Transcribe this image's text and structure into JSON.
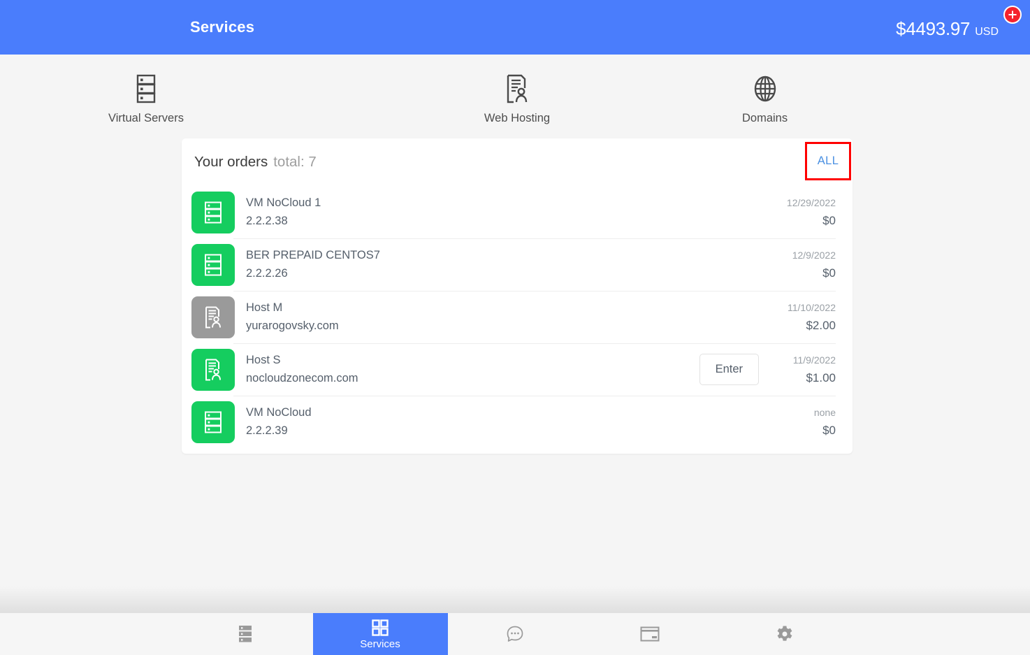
{
  "header": {
    "title": "Services",
    "balance_amount": "$4493.97",
    "balance_currency": "USD",
    "add_funds_icon": "plus-circle-icon",
    "background_color": "#4a7dfc",
    "add_funds_color": "#f5222d"
  },
  "categories": [
    {
      "label": "Virtual Servers",
      "icon": "server-rack-icon"
    },
    {
      "label": "Web Hosting",
      "icon": "document-person-icon"
    },
    {
      "label": "Domains",
      "icon": "globe-icon"
    }
  ],
  "orders_card": {
    "title": "Your orders",
    "total_label": "total: 7",
    "filter_label": "ALL",
    "filter_color": "#4a90e2",
    "highlight_color": "#ff0000",
    "rows": [
      {
        "name": "VM NoCloud 1",
        "sub": "2.2.2.38",
        "date": "12/29/2022",
        "price": "$0",
        "icon": "server-rack-icon",
        "icon_color": "#15cd5f",
        "action": ""
      },
      {
        "name": "BER PREPAID CENTOS7",
        "sub": "2.2.2.26",
        "date": "12/9/2022",
        "price": "$0",
        "icon": "server-rack-icon",
        "icon_color": "#15cd5f",
        "action": ""
      },
      {
        "name": "Host M",
        "sub": "yurarogovsky.com",
        "date": "11/10/2022",
        "price": "$2.00",
        "icon": "document-person-icon",
        "icon_color": "#9a9a9a",
        "action": ""
      },
      {
        "name": "Host S",
        "sub": "nocloudzonecom.com",
        "date": "11/9/2022",
        "price": "$1.00",
        "icon": "document-person-icon",
        "icon_color": "#15cd5f",
        "action": "Enter"
      },
      {
        "name": "VM NoCloud",
        "sub": "2.2.2.39",
        "date": "none",
        "price": "$0",
        "icon": "server-rack-icon",
        "icon_color": "#15cd5f",
        "action": ""
      }
    ]
  },
  "bottom_nav": {
    "active_color": "#4a7dfc",
    "items": [
      {
        "label": "",
        "icon": "server-rack-icon",
        "active": false
      },
      {
        "label": "Services",
        "icon": "grid-icon",
        "active": true
      },
      {
        "label": "",
        "icon": "chat-bubble-icon",
        "active": false
      },
      {
        "label": "",
        "icon": "credit-card-icon",
        "active": false
      },
      {
        "label": "",
        "icon": "gear-icon",
        "active": false
      }
    ]
  }
}
